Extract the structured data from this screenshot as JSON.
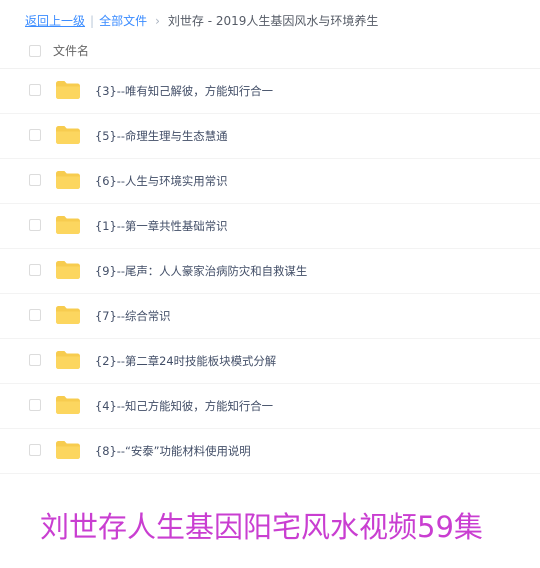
{
  "breadcrumb": {
    "back_label": "返回上一级",
    "separator": "|",
    "all_files_label": "全部文件",
    "arrow": "›",
    "current_folder": "刘世存 - 2019人生基因风水与环境养生"
  },
  "list_header": {
    "filename_label": "文件名"
  },
  "icons": {
    "folder": "folder-icon"
  },
  "colors": {
    "link": "#3b8cff",
    "folder": "#f7cc4f",
    "row_text": "#424e67",
    "watermark": "#c93ed1"
  },
  "files": [
    {
      "name": "{3}--唯有知己解彼，方能知行合一"
    },
    {
      "name": "{5}--命理生理与生态慧通"
    },
    {
      "name": "{6}--人生与环境实用常识"
    },
    {
      "name": "{1}--第一章共性基础常识"
    },
    {
      "name": "{9}--尾声：人人豪家治病防灾和自救谋生"
    },
    {
      "name": "{7}--综合常识"
    },
    {
      "name": "{2}--第二章24时技能板块模式分解"
    },
    {
      "name": "{4}--知己方能知彼，方能知行合一"
    },
    {
      "name": "{8}--“安泰”功能材料使用说明"
    }
  ],
  "watermark": {
    "text": "刘世存人生基因阳宅风水视频59集"
  }
}
